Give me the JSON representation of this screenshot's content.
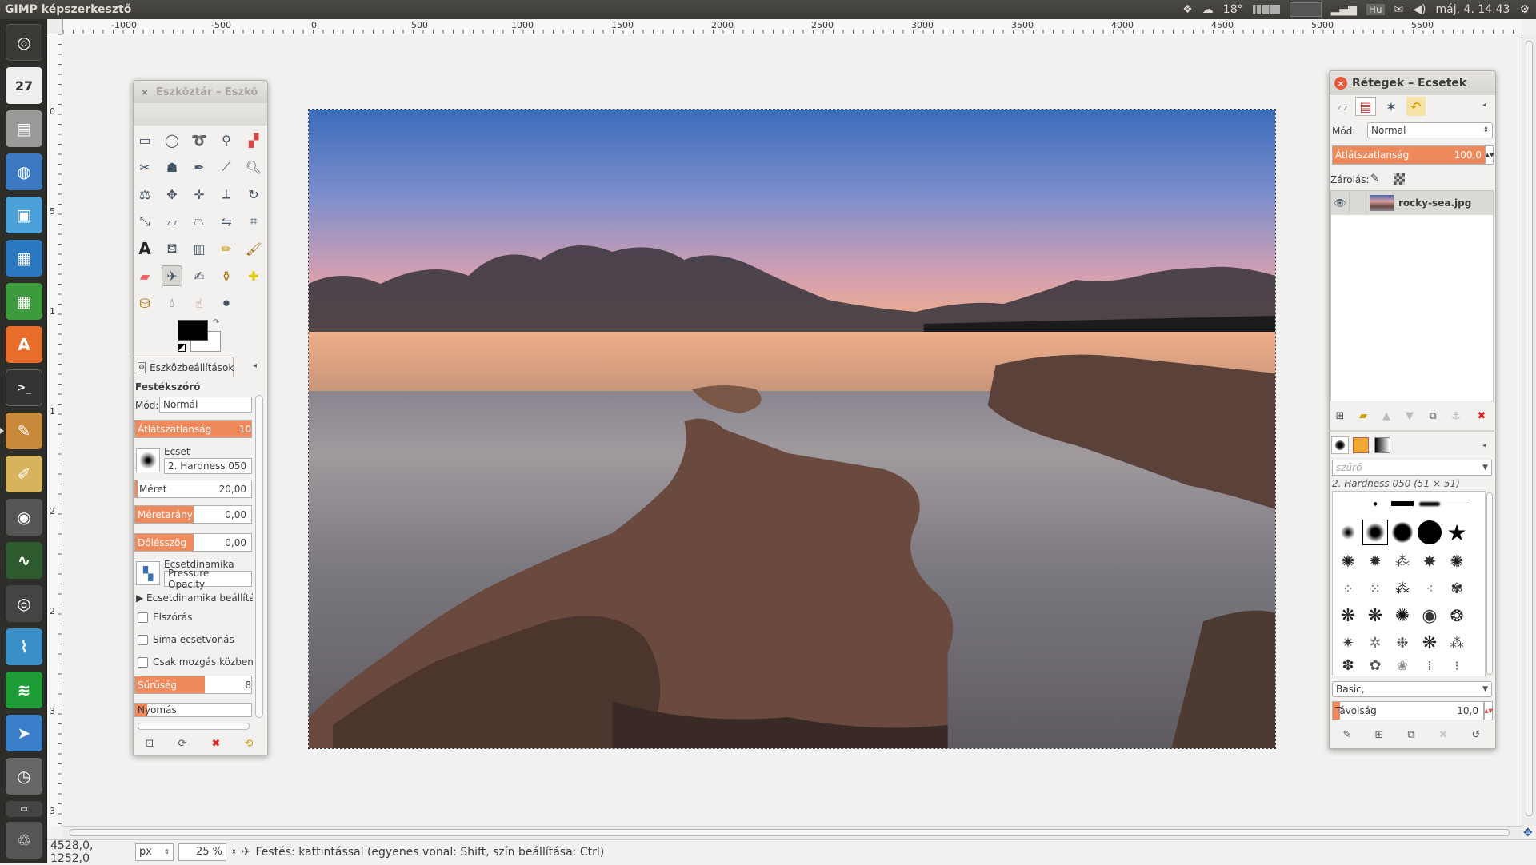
{
  "topbar": {
    "app_title": "GIMP képszerkesztő",
    "weather": "18°",
    "keyboard": "Hu",
    "datetime": "máj. 4. 14.43"
  },
  "launcher": {
    "items": [
      "dash-home",
      "calendar",
      "files",
      "browser",
      "image-viewer",
      "writer",
      "calc",
      "software-center",
      "terminal",
      "gimp",
      "text-editor",
      "camera",
      "system-monitor",
      "webcam",
      "sysmon-2",
      "spotify",
      "pointer-tool",
      "backup",
      "workspace",
      "trash"
    ],
    "calendar_day": "27"
  },
  "rulers": {
    "h_labels": [
      "-1000",
      "-500",
      "0",
      "500",
      "1000",
      "1500",
      "2000",
      "2500",
      "3000",
      "3500",
      "4000",
      "4500",
      "5000",
      "5500"
    ],
    "v_labels": [
      "0",
      "5",
      "1",
      "1",
      "2",
      "2",
      "3",
      "3"
    ]
  },
  "statusbar": {
    "coords": "4528,0, 1252,0",
    "unit": "px",
    "zoom": "25 %",
    "message": "Festés: kattintással (egyenes vonal: Shift, szín beállítása: Ctrl)"
  },
  "toolbox": {
    "title": "Eszköztár – Eszkö",
    "options_tab": "Eszközbeállítások",
    "tool_name": "Festékszóró",
    "mode_label": "Mód:",
    "mode_value": "Normál",
    "opacity_label": "Átlátszatlanság",
    "opacity_value": "10",
    "opacity_level": 1.0,
    "brush_label": "Ecset",
    "brush_value": "2. Hardness 050",
    "size_label": "Méret",
    "size_value": "20,00",
    "size_level": 0.02,
    "aspect_label": "Méretarány",
    "aspect_value": "0,00",
    "aspect_level": 0.5,
    "angle_label": "Dőlésszög",
    "angle_value": "0,00",
    "angle_level": 0.5,
    "dynamics_label": "Ecsetdinamika",
    "dynamics_value": "Pressure Opacity",
    "dynamics_settings": "Ecsetdinamika beállítás",
    "scatter": "Elszórás",
    "smooth": "Sima ecsetvonás",
    "motion_only": "Csak mozgás közben",
    "rate_label": "Sűrűség",
    "rate_value": "8",
    "rate_level": 0.6,
    "pressure_label": "Nyomás",
    "pressure_level": 0.1
  },
  "layers": {
    "title": "Rétegek – Ecsetek",
    "mode_label": "Mód:",
    "mode_value": "Normal",
    "opacity_label": "Átlátszatlanság",
    "opacity_value": "100,0",
    "opacity_level": 1.0,
    "lock_label": "Zárolás:",
    "layer_name": "rocky-sea.jpg"
  },
  "brushes": {
    "filter_placeholder": "szűrő",
    "selected": "2. Hardness 050 (51 × 51)",
    "preset": "Basic,",
    "spacing_label": "Távolság",
    "spacing_value": "10,0",
    "spacing_level": 0.05
  },
  "colors": {
    "accent": "#f08a5d",
    "topbar": "#3c3b37",
    "launcher": "#2d2d2a",
    "close_red": "#e8583a"
  }
}
